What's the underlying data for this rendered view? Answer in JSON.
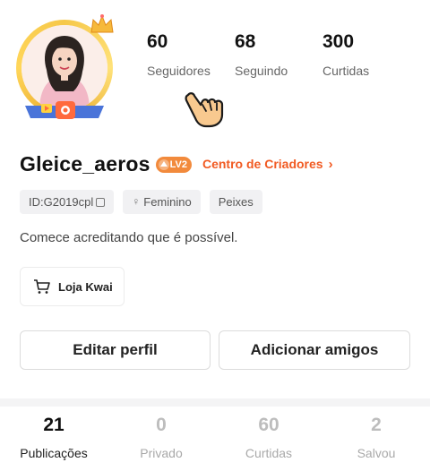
{
  "profile": {
    "username": "Gleice_aeros",
    "level": "LV2",
    "creator_center": "Centro de Criadores",
    "bio": "Comece acreditando que é possível."
  },
  "stats": [
    {
      "value": "60",
      "label": "Seguidores"
    },
    {
      "value": "68",
      "label": "Seguindo"
    },
    {
      "value": "300",
      "label": "Curtidas"
    }
  ],
  "tags": {
    "id": "ID:G2019cpl",
    "gender": "Feminino",
    "sign": "Peixes"
  },
  "shop": {
    "label": "Loja Kwai"
  },
  "actions": {
    "edit": "Editar perfil",
    "add_friends": "Adicionar amigos"
  },
  "tabs": [
    {
      "value": "21",
      "label": "Publicações"
    },
    {
      "value": "0",
      "label": "Privado"
    },
    {
      "value": "60",
      "label": "Curtidas"
    },
    {
      "value": "2",
      "label": "Salvou"
    }
  ],
  "colors": {
    "accent": "#f15a22",
    "level_badge": "#f28a3c",
    "avatar_ring": "#f6c84a"
  }
}
